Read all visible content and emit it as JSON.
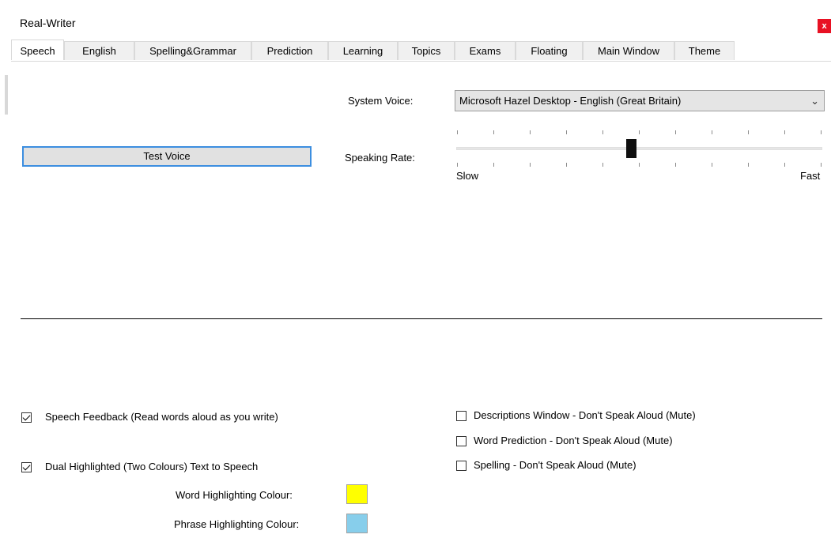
{
  "window": {
    "title": "Real-Writer",
    "close_label": "x"
  },
  "tabs": [
    {
      "label": "Speech",
      "active": true
    },
    {
      "label": "English"
    },
    {
      "label": "Spelling&Grammar"
    },
    {
      "label": "Prediction"
    },
    {
      "label": "Learning"
    },
    {
      "label": "Topics"
    },
    {
      "label": "Exams"
    },
    {
      "label": "Floating"
    },
    {
      "label": "Main Window"
    },
    {
      "label": "Theme"
    }
  ],
  "speech": {
    "test_voice_label": "Test Voice",
    "system_voice_label": "System Voice:",
    "system_voice_value": "Microsoft Hazel Desktop - English (Great Britain)",
    "speaking_rate_label": "Speaking Rate:",
    "rate_slow_label": "Slow",
    "rate_fast_label": "Fast",
    "rate_value_fraction": 0.48,
    "options_left": [
      {
        "label": "Speech Feedback (Read words aloud as you write)",
        "checked": true
      },
      {
        "label": "Dual Highlighted (Two Colours) Text to Speech",
        "checked": true
      }
    ],
    "options_right": [
      {
        "label": "Descriptions Window - Don't Speak Aloud (Mute)",
        "checked": false
      },
      {
        "label": "Word Prediction - Don't Speak Aloud (Mute)",
        "checked": false
      },
      {
        "label": "Spelling - Don't Speak Aloud (Mute)",
        "checked": false
      }
    ],
    "word_colour_label": "Word Highlighting Colour:",
    "word_colour": "#ffff00",
    "phrase_colour_label": "Phrase Highlighting Colour:",
    "phrase_colour": "#87ceeb"
  }
}
